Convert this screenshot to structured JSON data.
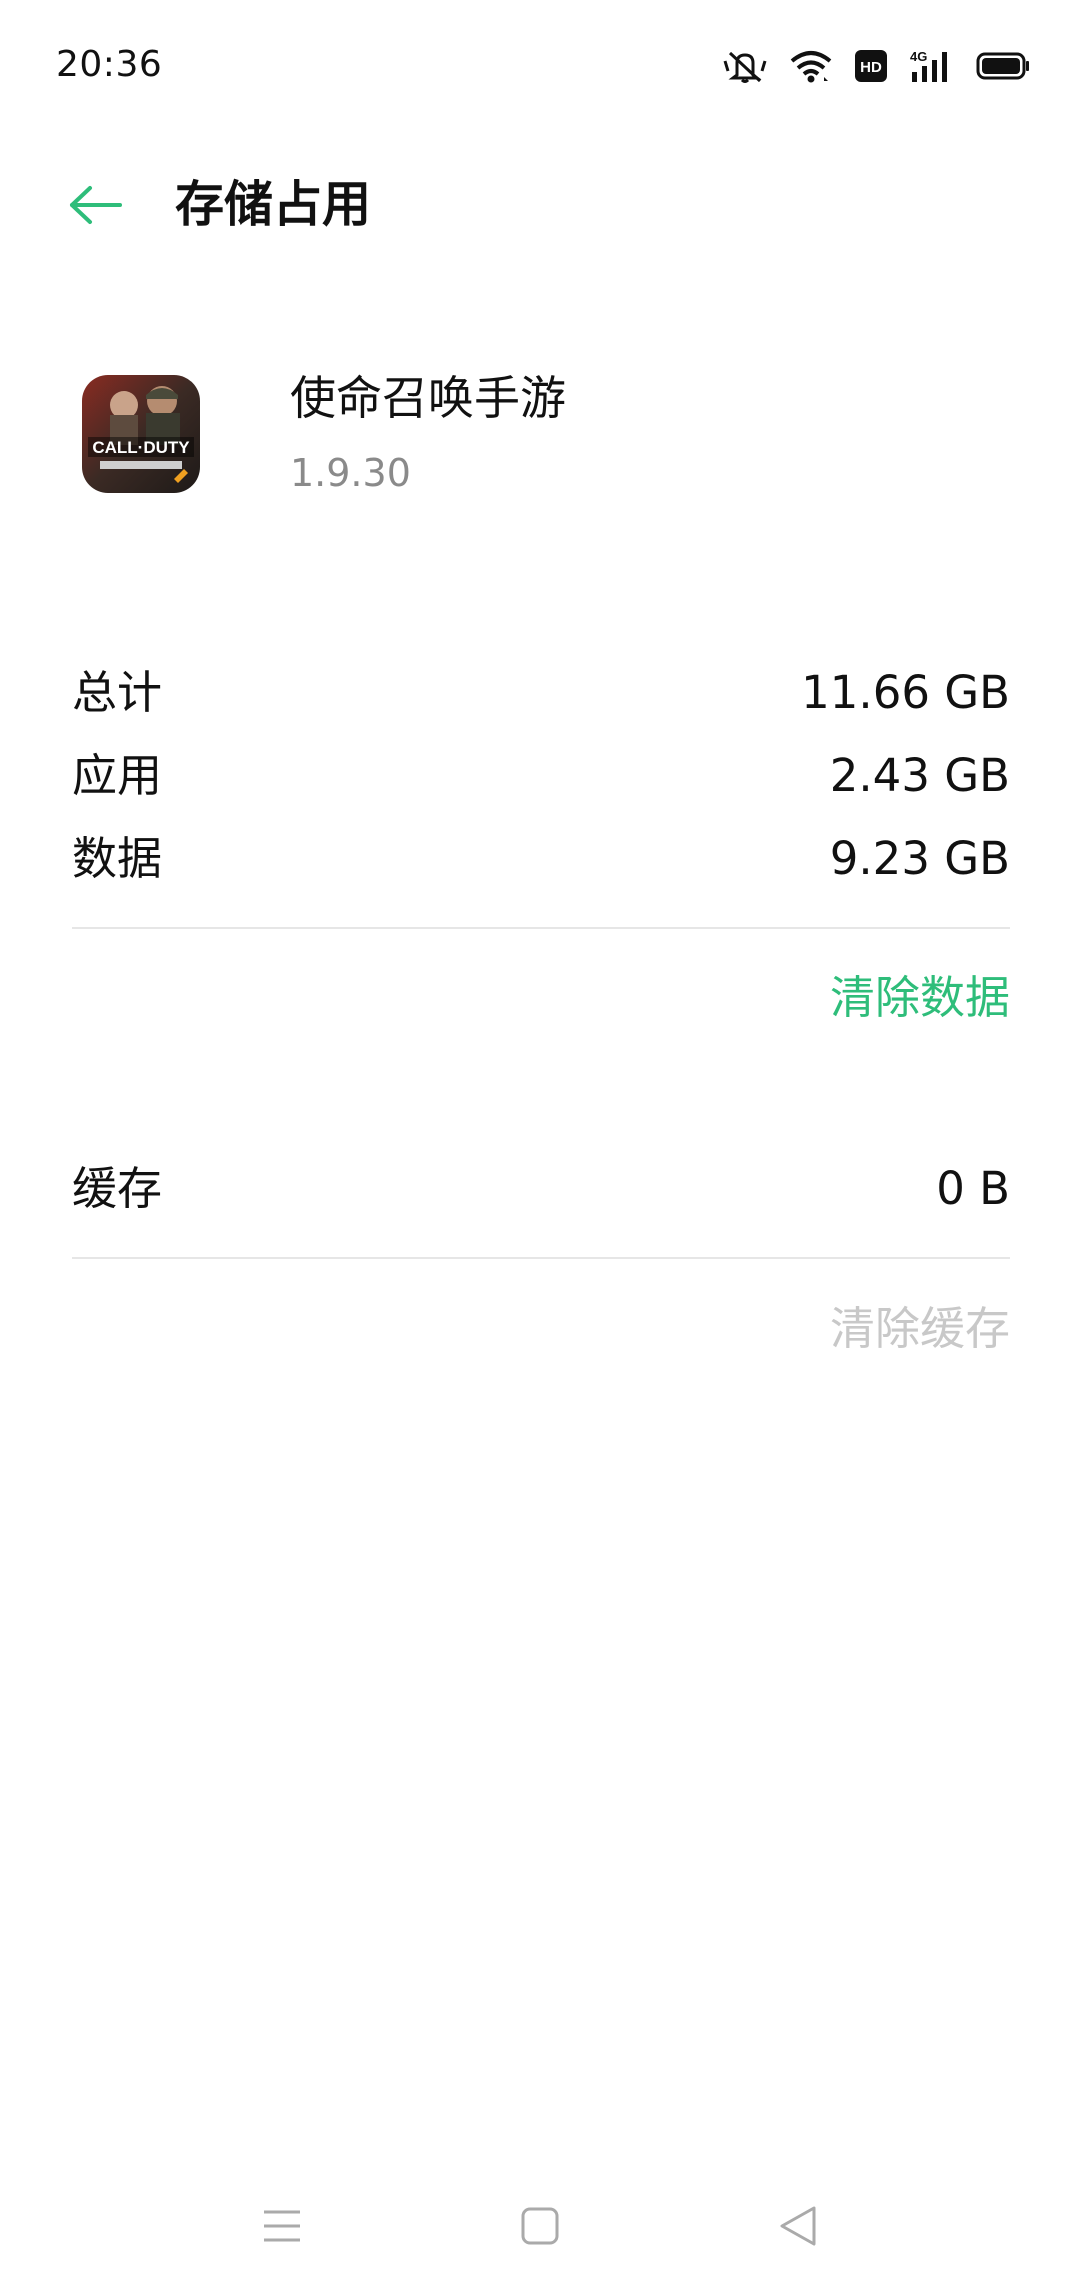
{
  "status_bar": {
    "time": "20:36",
    "icons": [
      "mute-icon",
      "wifi-icon",
      "hd-icon",
      "signal-4g-icon",
      "battery-icon"
    ],
    "hd_text": "HD",
    "network_text": "4G"
  },
  "header": {
    "back_icon": "arrow-left-icon",
    "title": "存储占用"
  },
  "app": {
    "name": "使命召唤手游",
    "version": "1.9.30",
    "icon_text": "CALL·DUTY"
  },
  "storage": {
    "total_label": "总计",
    "total_value": "11.66 GB",
    "app_label": "应用",
    "app_value": "2.43 GB",
    "data_label": "数据",
    "data_value": "9.23 GB",
    "clear_data_label": "清除数据",
    "cache_label": "缓存",
    "cache_value": "0 B",
    "clear_cache_label": "清除缓存"
  },
  "nav_bar": {
    "icons": [
      "menu-icon",
      "home-icon",
      "back-triangle-icon"
    ]
  },
  "colors": {
    "accent": "#2ebd7a",
    "disabled": "#c8c8c8",
    "secondary_text": "#8a8a8a",
    "divider": "#e6e6e6"
  }
}
